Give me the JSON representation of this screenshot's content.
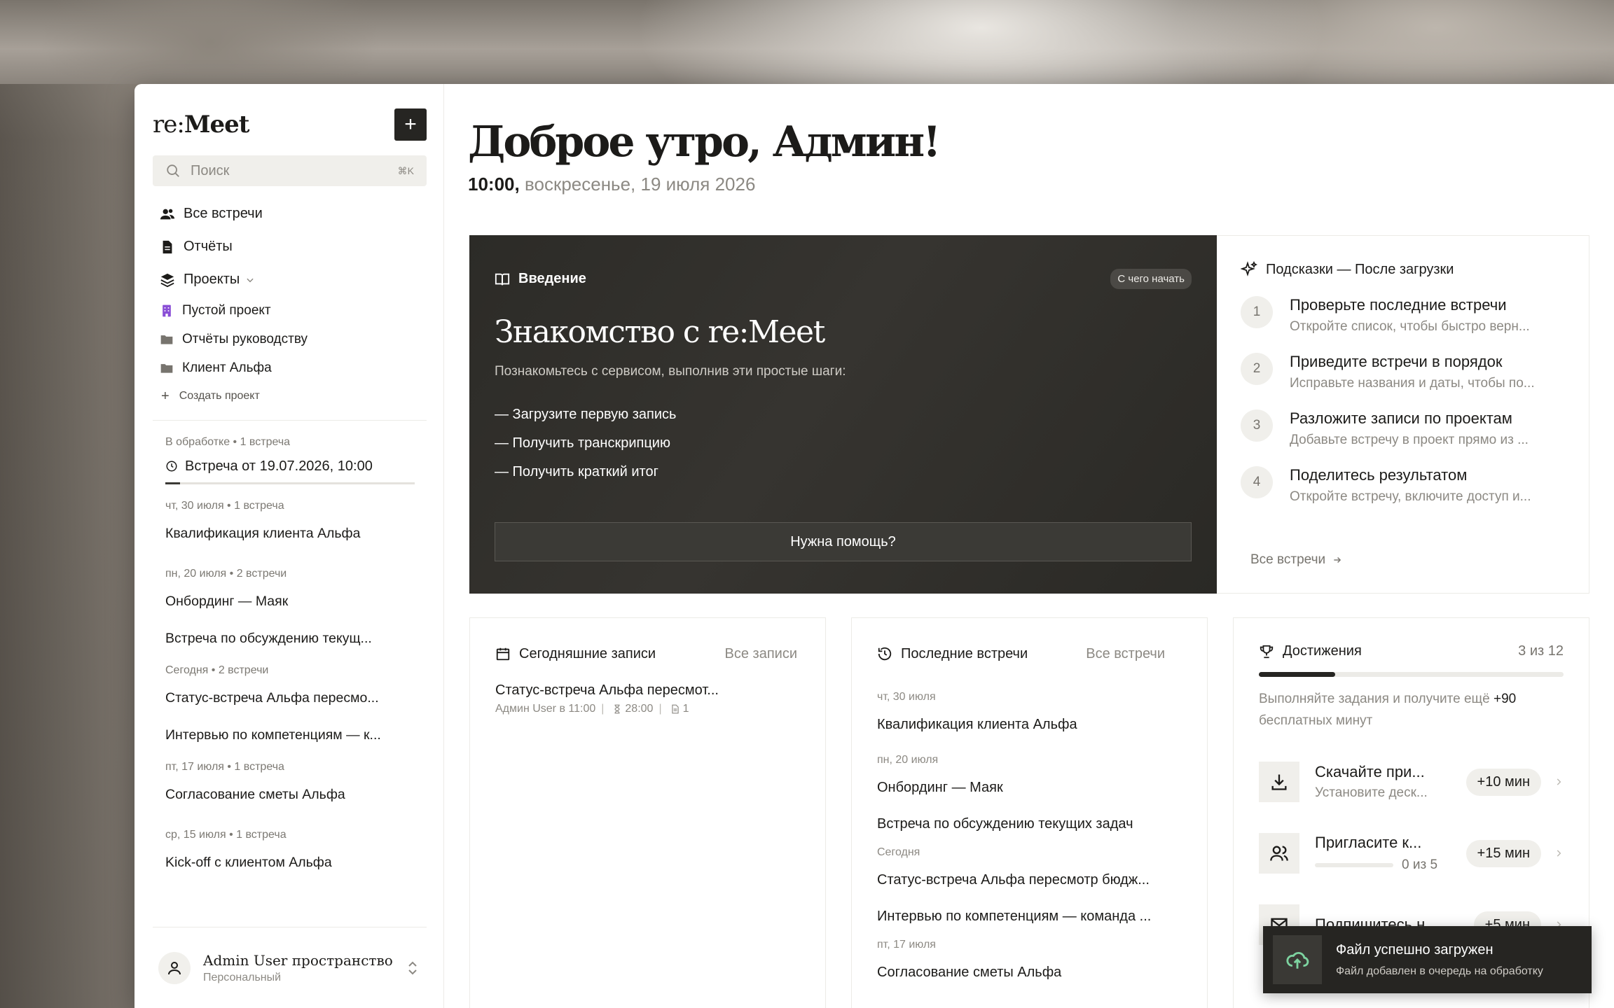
{
  "app": {
    "logo_prefix": "re:",
    "logo_name": "Meet",
    "new_label": "+"
  },
  "search": {
    "placeholder": "Поиск",
    "shortcut": "⌘K"
  },
  "nav": [
    {
      "label": "Все встречи",
      "icon": "users-icon"
    },
    {
      "label": "Отчёты",
      "icon": "document-icon"
    },
    {
      "label": "Проекты",
      "icon": "layers-icon"
    }
  ],
  "projects": [
    {
      "label": "Пустой проект",
      "icon": "building-icon",
      "color": "#8a4fd6"
    },
    {
      "label": "Отчёты руководству",
      "icon": "folder-icon"
    },
    {
      "label": "Клиент Альфа",
      "icon": "folder-icon"
    }
  ],
  "create_project": "Создать проект",
  "processing": {
    "label": "В обработке • 1 встреча",
    "meeting": "Встреча от 19.07.2026, 10:00",
    "progress": 0.06
  },
  "sidebar_groups": [
    {
      "label": "чт, 30 июля • 1 встреча",
      "items": [
        "Квалификация клиента Альфа"
      ]
    },
    {
      "label": "пн, 20 июля • 2 встречи",
      "items": [
        "Онбординг — Маяк",
        "Встреча по обсуждению текущ..."
      ]
    },
    {
      "label": "Сегодня • 2 встречи",
      "items": [
        "Статус-встреча Альфа пересмо...",
        "Интервью по компетенциям — к..."
      ]
    },
    {
      "label": "пт, 17 июля • 1 встреча",
      "items": [
        "Согласование сметы Альфа"
      ]
    },
    {
      "label": "ср, 15 июля • 1 встреча",
      "items": [
        "Kick-off с клиентом Альфа"
      ]
    }
  ],
  "user": {
    "name": "Admin User пространство",
    "plan": "Персональный"
  },
  "greeting": "Доброе утро, Админ!",
  "datetime": {
    "time": "10:00,",
    "date": " воскресенье, 19 июля 2026"
  },
  "intro": {
    "section": "Введение",
    "badge": "С чего начать",
    "title": "Знакомство с re:Meet",
    "subtitle": "Познакомьтесь с сервисом, выполнив эти простые шаги:",
    "steps": [
      "— Загрузите первую запись",
      "— Получить транскрипцию",
      "— Получить краткий итог"
    ],
    "help_button": "Нужна помощь?"
  },
  "tips": {
    "title": "Подсказки — После загрузки",
    "items": [
      {
        "num": "1",
        "title": "Проверьте последние встречи",
        "desc": "Откройте список, чтобы быстро верн..."
      },
      {
        "num": "2",
        "title": "Приведите встречи в порядок",
        "desc": "Исправьте названия и даты, чтобы по..."
      },
      {
        "num": "3",
        "title": "Разложите записи по проектам",
        "desc": "Добавьте встречу в проект прямо из ..."
      },
      {
        "num": "4",
        "title": "Поделитесь результатом",
        "desc": "Откройте встречу, включите доступ и..."
      }
    ],
    "all_link": "Все встречи"
  },
  "today": {
    "title": "Сегодняшние записи",
    "link": "Все записи",
    "record": {
      "title": "Статус-встреча Альфа пересмот...",
      "author": "Админ User в 11:00",
      "duration": "28:00",
      "docs": "1"
    }
  },
  "recent": {
    "title": "Последние встречи",
    "link": "Все встречи",
    "groups": [
      {
        "label": "чт, 30 июля",
        "items": [
          "Квалификация клиента Альфа"
        ]
      },
      {
        "label": "пн, 20 июля",
        "items": [
          "Онбординг — Маяк",
          "Встреча по обсуждению текущих задач"
        ]
      },
      {
        "label": "Сегодня",
        "items": [
          "Статус-встреча Альфа пересмотр бюдж...",
          "Интервью по компетенциям — команда ..."
        ]
      },
      {
        "label": "пт, 17 июля",
        "items": [
          "Согласование сметы Альфа"
        ]
      }
    ]
  },
  "achievements": {
    "title": "Достижения",
    "count": "3 из 12",
    "progress": 0.25,
    "desc_prefix": "Выполняйте задания и получите ещё ",
    "desc_bonus": "+90",
    "desc_suffix": " бесплатных минут",
    "tasks": [
      {
        "title": "Скачайте при...",
        "sub": "Установите деск...",
        "reward": "+10 мин",
        "icon": "download-icon"
      },
      {
        "title": "Пригласите к...",
        "progress_text": "0 из 5",
        "reward": "+15 мин",
        "icon": "people-icon"
      },
      {
        "title": "Подпишитесь н...",
        "reward": "+5 мин",
        "icon": "mail-icon"
      }
    ]
  },
  "toast": {
    "title": "Файл успешно загружен",
    "subtitle": "Файл добавлен в очередь на обработку"
  }
}
